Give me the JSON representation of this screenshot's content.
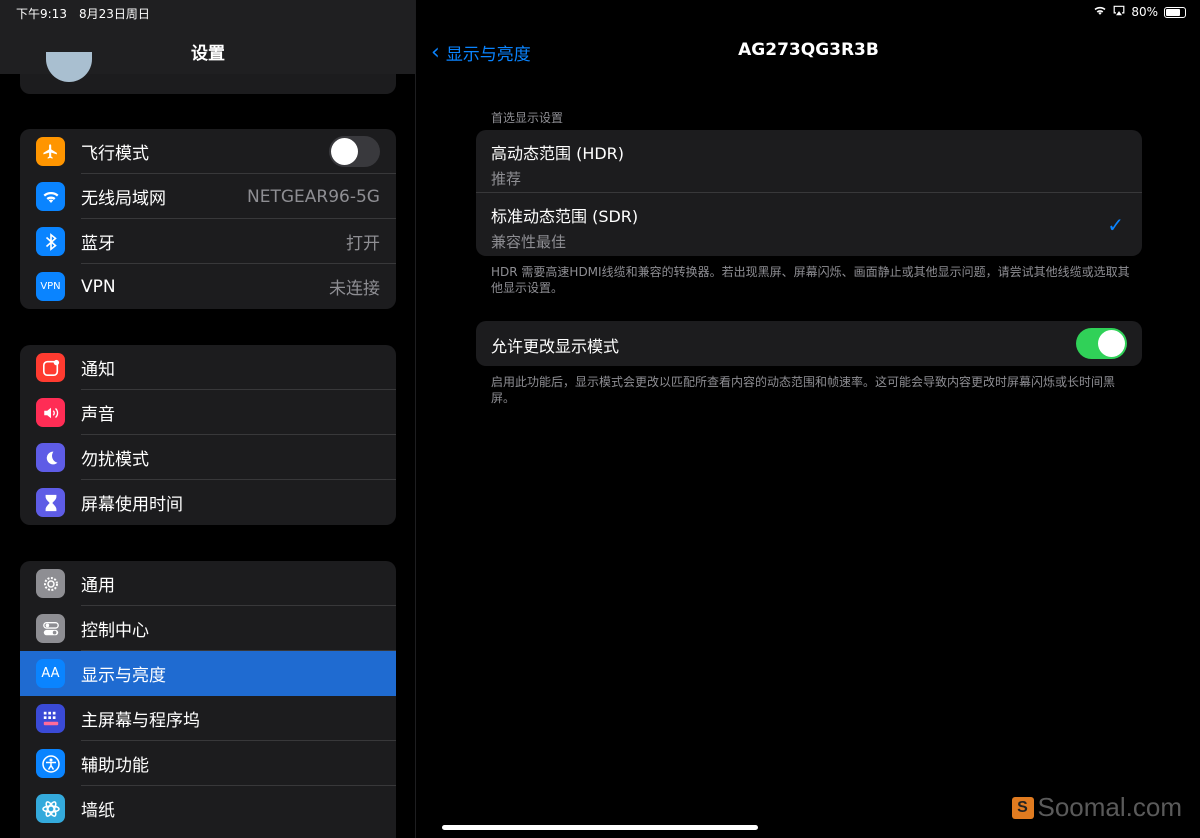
{
  "status": {
    "time": "下午9:13",
    "date": "8月23日周日",
    "battery": "80%",
    "battery_level": 0.8
  },
  "sidebar": {
    "title": "设置",
    "group1": [
      {
        "label": "飞行模式",
        "icon": "airplane-icon",
        "color": "#ff9500"
      },
      {
        "label": "无线局域网",
        "value": "NETGEAR96-5G",
        "icon": "wifi-icon",
        "color": "#0a84ff"
      },
      {
        "label": "蓝牙",
        "value": "打开",
        "icon": "bluetooth-icon",
        "color": "#0a84ff"
      },
      {
        "label": "VPN",
        "value": "未连接",
        "icon": "vpn-icon",
        "color": "#0a84ff",
        "icon_text": "VPN"
      }
    ],
    "group2": [
      {
        "label": "通知",
        "icon": "notification-icon",
        "color": "#ff3b30"
      },
      {
        "label": "声音",
        "icon": "speaker-icon",
        "color": "#ff2d55"
      },
      {
        "label": "勿扰模式",
        "icon": "moon-icon",
        "color": "#5e5ce6"
      },
      {
        "label": "屏幕使用时间",
        "icon": "hourglass-icon",
        "color": "#5e5ce6"
      }
    ],
    "group3": [
      {
        "label": "通用",
        "icon": "gear-icon",
        "color": "#8e8e93"
      },
      {
        "label": "控制中心",
        "icon": "switches-icon",
        "color": "#8e8e93"
      },
      {
        "label": "显示与亮度",
        "icon": "display-icon",
        "color": "#0a84ff",
        "icon_text": "AA"
      },
      {
        "label": "主屏幕与程序坞",
        "icon": "grid-icon",
        "color": "#3a4ad6"
      },
      {
        "label": "辅助功能",
        "icon": "accessibility-icon",
        "color": "#0a84ff"
      },
      {
        "label": "墙纸",
        "icon": "wallpaper-icon",
        "color": "#34aadc"
      }
    ]
  },
  "main": {
    "back_label": "显示与亮度",
    "title": "AG273QG3R3B",
    "section_header": "首选显示设置",
    "options": [
      {
        "title": "高动态范围 (HDR)",
        "subtitle": "推荐"
      },
      {
        "title": "标准动态范围 (SDR)",
        "subtitle": "兼容性最佳"
      }
    ],
    "footnote1": "HDR 需要高速HDMI线缆和兼容的转换器。若出现黑屏、屏幕闪烁、画面静止或其他显示问题，请尝试其他线缆或选取其他显示设置。",
    "toggle_label": "允许更改显示模式",
    "footnote2": "启用此功能后，显示模式会更改以匹配所查看内容的动态范围和帧速率。这可能会导致内容更改时屏幕闪烁或长时间黑屏。"
  },
  "watermark": "Soomal.com"
}
